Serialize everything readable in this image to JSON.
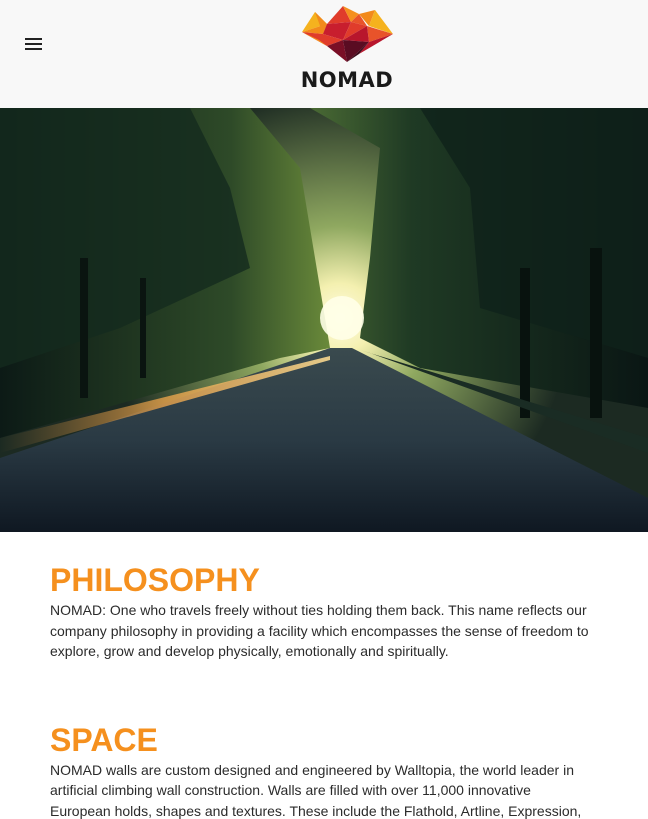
{
  "header": {
    "menu_icon": "hamburger-menu-icon",
    "logo_text": "NOMAD",
    "logo_colors": [
      "#f5b21e",
      "#f28a1b",
      "#e03c2b",
      "#b8162c",
      "#7a0f26",
      "#3a0a1a"
    ]
  },
  "hero": {
    "image_description_icon": "tree-lined-road-sunrise-photo"
  },
  "sections": [
    {
      "title": "PHILOSOPHY",
      "body": "NOMAD: One who travels freely without ties holding them back. This name reflects our company philosophy in providing a facility which encompasses the sense of freedom to explore, grow and develop physically, emotionally and spiritually."
    },
    {
      "title": "SPACE",
      "body": "NOMAD walls are custom designed and engineered by Walltopia, the world leader in artificial climbing wall construction. Walls are filled with over 11,000 innovative European holds, shapes and textures. These include the Flathold, Artline, Expression,"
    }
  ],
  "colors": {
    "accent": "#f5901e",
    "header_bg": "#f8f8f8",
    "text": "#2b2b2b"
  }
}
